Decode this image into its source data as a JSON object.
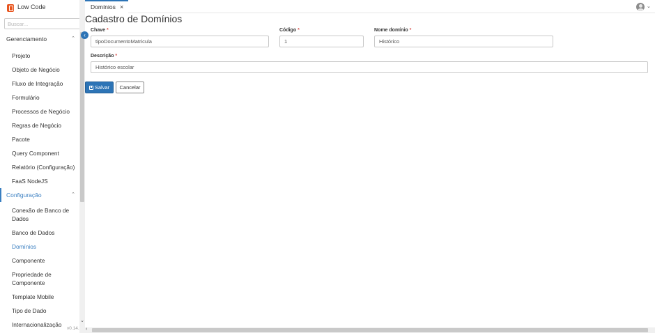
{
  "app": {
    "title": "Low Code",
    "version": "v0.14.0",
    "brand_color": "#e8551f",
    "accent_color": "#2d74b6"
  },
  "sidebar": {
    "search_placeholder": "Buscar...",
    "groups": [
      {
        "label": "Gerenciamento",
        "expanded": true,
        "items": [
          {
            "label": "Projeto"
          },
          {
            "label": "Objeto de Negócio"
          },
          {
            "label": "Fluxo de Integração"
          },
          {
            "label": "Formulário"
          },
          {
            "label": "Processos de Negócio"
          },
          {
            "label": "Regras de Negócio"
          },
          {
            "label": "Pacote"
          },
          {
            "label": "Query Component"
          },
          {
            "label": "Relatório (Configuração)"
          },
          {
            "label": "FaaS NodeJS"
          }
        ]
      },
      {
        "label": "Configuração",
        "expanded": true,
        "active": true,
        "items": [
          {
            "label": "Conexão de Banco de Dados"
          },
          {
            "label": "Banco de Dados"
          },
          {
            "label": "Domínios",
            "active": true
          },
          {
            "label": "Componente"
          },
          {
            "label": "Propriedade de Componente"
          },
          {
            "label": "Template Mobile"
          },
          {
            "label": "Tipo de Dado"
          },
          {
            "label": "Internacionalização"
          }
        ]
      }
    ]
  },
  "tabs": [
    {
      "label": "Domínios",
      "close": "×",
      "active": true
    }
  ],
  "page": {
    "title": "Cadastro de Domínios"
  },
  "form": {
    "chave": {
      "label": "Chave",
      "required": "*",
      "value": "tipoDocumentoMatricula"
    },
    "codigo": {
      "label": "Código",
      "required": "*",
      "value": "1"
    },
    "nome": {
      "label": "Nome domínio",
      "required": "*",
      "value": "Histórico"
    },
    "descricao": {
      "label": "Descrição",
      "required": "*",
      "value": "Histórico escolar"
    }
  },
  "actions": {
    "save_label": "Salvar",
    "cancel_label": "Cancelar"
  },
  "icons": {
    "collapse": "chevron-left-icon",
    "user": "user-avatar-icon",
    "save": "floppy-disk-icon"
  }
}
